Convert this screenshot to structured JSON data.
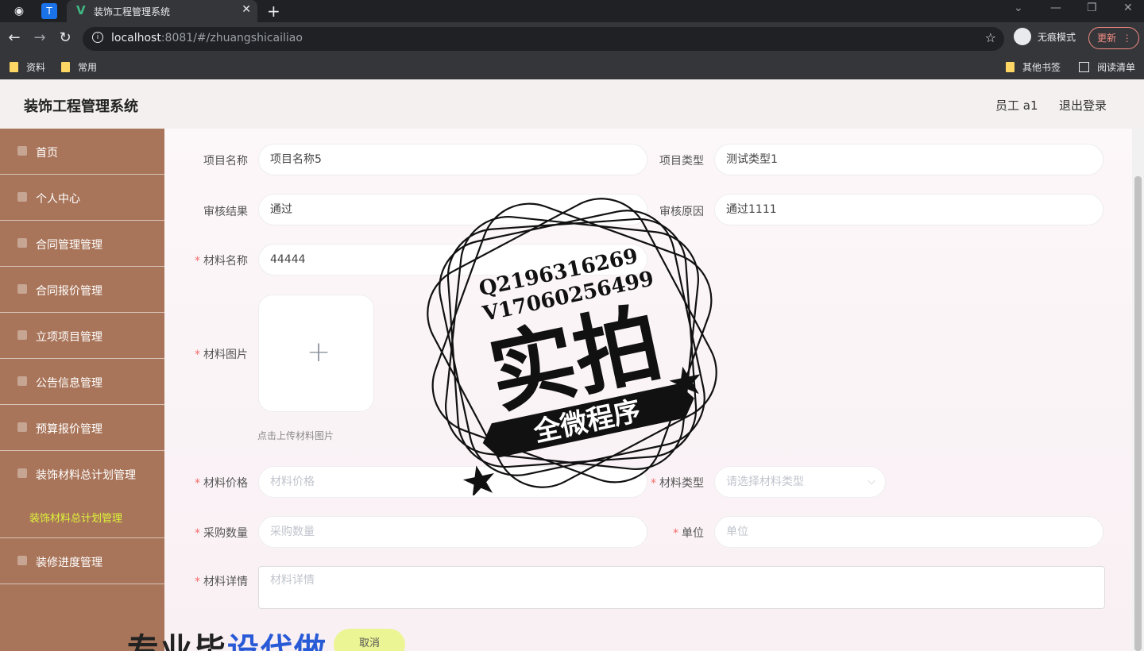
{
  "browser": {
    "tab_title": "装饰工程管理系统",
    "url_host": "localhost",
    "url_rest": ":8081/#/zhuangshicailiao",
    "incognito_label": "无痕模式",
    "update_label": "更新",
    "bookmarks": [
      "资料",
      "常用"
    ],
    "other_bookmarks": "其他书签",
    "reading_list": "阅读清单"
  },
  "header": {
    "title": "装饰工程管理系统",
    "user": "员工 a1",
    "logout": "退出登录"
  },
  "sidebar": {
    "items": [
      {
        "label": "首页"
      },
      {
        "label": "个人中心"
      },
      {
        "label": "合同管理管理"
      },
      {
        "label": "合同报价管理"
      },
      {
        "label": "立项项目管理"
      },
      {
        "label": "公告信息管理"
      },
      {
        "label": "预算报价管理"
      },
      {
        "label": "装饰材料总计划管理"
      },
      {
        "label": "装修进度管理"
      }
    ],
    "sub_active": "装饰材料总计划管理"
  },
  "form": {
    "project_name": {
      "label": "项目名称",
      "value": "项目名称5"
    },
    "project_type": {
      "label": "项目类型",
      "value": "测试类型1"
    },
    "review_result": {
      "label": "审核结果",
      "value": "通过"
    },
    "review_reason": {
      "label": "审核原因",
      "value": "通过1111"
    },
    "material_name": {
      "label": "材料名称",
      "value": "44444"
    },
    "material_image": {
      "label": "材料图片",
      "hint": "点击上传材料图片"
    },
    "material_price": {
      "label": "材料价格",
      "placeholder": "材料价格"
    },
    "material_type": {
      "label": "材料类型",
      "placeholder": "请选择材料类型"
    },
    "purchase_qty": {
      "label": "采购数量",
      "placeholder": "采购数量"
    },
    "unit": {
      "label": "单位",
      "placeholder": "单位"
    },
    "material_detail": {
      "label": "材料详情",
      "placeholder": "材料详情"
    },
    "cancel": "取消"
  },
  "watermark": {
    "qq": "Q2196316269",
    "wechat": "V17060256499",
    "big": "实拍",
    "banner": "全微程序",
    "bottom_a": "专业毕",
    "bottom_b": "设代做"
  }
}
